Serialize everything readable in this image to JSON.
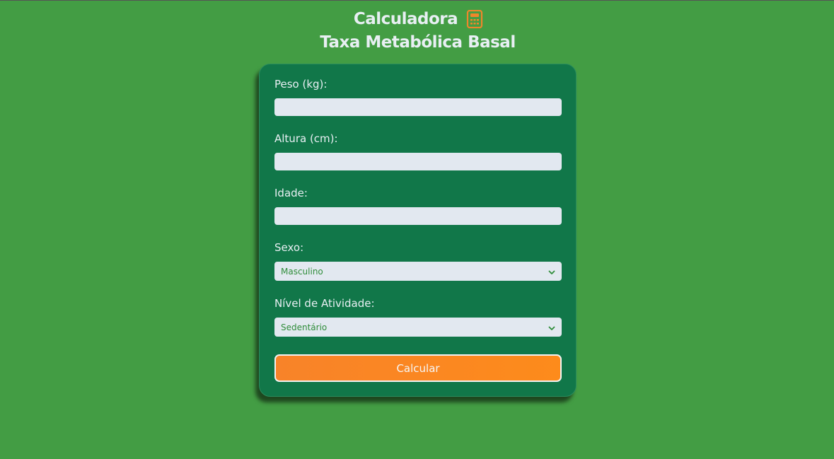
{
  "header": {
    "title": "Calculadora",
    "title_icon": "calculator-icon",
    "subtitle": "Taxa Metabólica Basal"
  },
  "form": {
    "weight": {
      "label": "Peso (kg):",
      "value": ""
    },
    "height": {
      "label": "Altura (cm):",
      "value": ""
    },
    "age": {
      "label": "Idade:",
      "value": ""
    },
    "sex": {
      "label": "Sexo:",
      "selected": "Masculino"
    },
    "activity": {
      "label": "Nível de Atividade:",
      "selected": "Sedentário"
    },
    "submit_label": "Calcular"
  },
  "colors": {
    "background": "#439d44",
    "card": "#117749",
    "accent": "#fd8b1b",
    "input_bg": "#e2e8f0",
    "text_light": "#e8eff3"
  }
}
